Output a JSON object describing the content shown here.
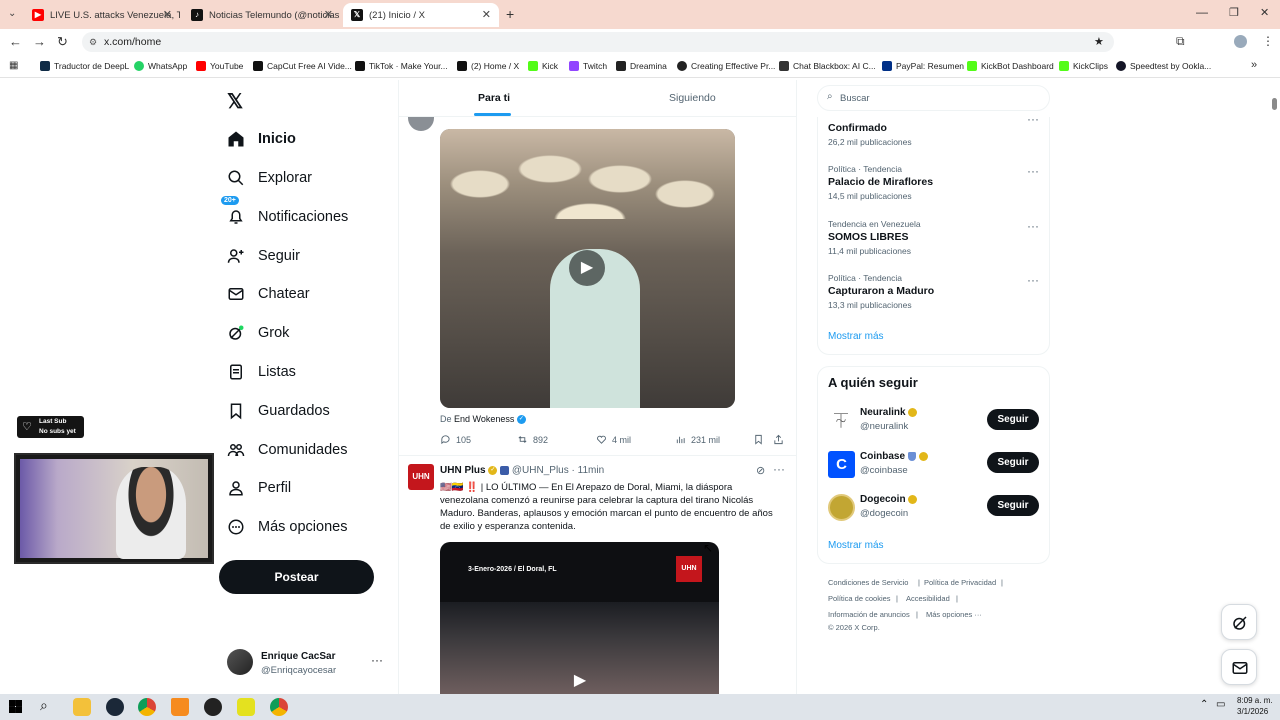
{
  "browser": {
    "tabs": [
      {
        "title": "LIVE U.S. attacks Venezuela, Tru",
        "icon": "youtube-icon",
        "active": false
      },
      {
        "title": "Noticias Telemundo (@noticias",
        "icon": "tiktok-icon",
        "active": false
      },
      {
        "title": "(21) Inicio / X",
        "icon": "x-icon",
        "active": true
      }
    ],
    "url": "x.com/home",
    "bookmarks": [
      "Traductor de DeepL",
      "WhatsApp",
      "YouTube",
      "CapCut Free AI Vide...",
      "TikTok · Make Your...",
      "(2) Home / X",
      "Kick",
      "Twitch",
      "Dreamina",
      "Creating Effective Pr...",
      "Chat Blackbox: AI C...",
      "PayPal: Resumen",
      "KickBot Dashboard",
      "KickClips",
      "Speedtest by Ookla..."
    ]
  },
  "sidebar": {
    "items": [
      {
        "label": "Inicio",
        "icon": "home-icon",
        "active": true
      },
      {
        "label": "Explorar",
        "icon": "search-icon"
      },
      {
        "label": "Notificaciones",
        "icon": "bell-icon",
        "badge": "20+"
      },
      {
        "label": "Seguir",
        "icon": "follow-icon"
      },
      {
        "label": "Chatear",
        "icon": "mail-icon"
      },
      {
        "label": "Grok",
        "icon": "grok-icon"
      },
      {
        "label": "Listas",
        "icon": "list-icon"
      },
      {
        "label": "Guardados",
        "icon": "bookmark-icon"
      },
      {
        "label": "Comunidades",
        "icon": "people-icon"
      },
      {
        "label": "Perfil",
        "icon": "person-icon"
      },
      {
        "label": "Más opciones",
        "icon": "more-circle-icon"
      }
    ],
    "post_button": "Postear",
    "account": {
      "name": "Enrique CacSar",
      "handle": "@Enriqcayocesar"
    }
  },
  "stream_overlay": {
    "line1": "Last Sub",
    "line2": "No subs yet"
  },
  "feed": {
    "tabs": [
      "Para ti",
      "Siguiendo"
    ],
    "post1": {
      "via_prefix": "De",
      "via_name": "End Wokeness",
      "replies": "105",
      "reposts": "892",
      "likes": "4 mil",
      "views": "231 mil"
    },
    "post2": {
      "name": "UHN Plus",
      "handle": "@UHN_Plus",
      "time": "· 11min",
      "text": "🇺🇸🇻🇪 ‼️ | LO ÚLTIMO — En El Arepazo de Doral, Miami, la diáspora venezolana comenzó a reunirse para celebrar la captura del tirano Nicolás Maduro. Banderas, aplausos y emoción marcan el punto de encuentro de años de exilio y esperanza contenida.",
      "video_caption": "3-Enero-2026 / El Doral, FL",
      "video_logo": "UHN"
    }
  },
  "right": {
    "search_placeholder": "Buscar",
    "trends": [
      {
        "category": "",
        "title": "Confirmado",
        "count": "26,2 mil publicaciones"
      },
      {
        "category": "Política · Tendencia",
        "title": "Palacio de Miraflores",
        "count": "14,5 mil publicaciones"
      },
      {
        "category": "Tendencia en Venezuela",
        "title": "SOMOS LIBRES",
        "count": "11,4 mil publicaciones"
      },
      {
        "category": "Política · Tendencia",
        "title": "Capturaron a Maduro",
        "count": "13,3 mil publicaciones"
      }
    ],
    "show_more": "Mostrar más",
    "who_to_follow_title": "A quién seguir",
    "follow": [
      {
        "name": "Neuralink",
        "handle": "@neuralink",
        "button": "Seguir"
      },
      {
        "name": "Coinbase",
        "handle": "@coinbase",
        "button": "Seguir"
      },
      {
        "name": "Dogecoin",
        "handle": "@dogecoin",
        "button": "Seguir"
      }
    ],
    "show_more_2": "Mostrar más",
    "footer": {
      "terms": "Condiciones de Servicio",
      "privacy": "Política de Privacidad",
      "cookies": "Política de cookies",
      "accessibility": "Accesibilidad",
      "ads": "Información de anuncios",
      "more": "Más opciones ···",
      "copyright": "© 2026 X Corp."
    }
  },
  "taskbar": {
    "time": "8:09 a. m.",
    "date": "3/1/2026"
  },
  "colors": {
    "accent": "#1d9bf0",
    "tabbar": "#f6d9cf",
    "gold_badge": "#e2b719"
  }
}
